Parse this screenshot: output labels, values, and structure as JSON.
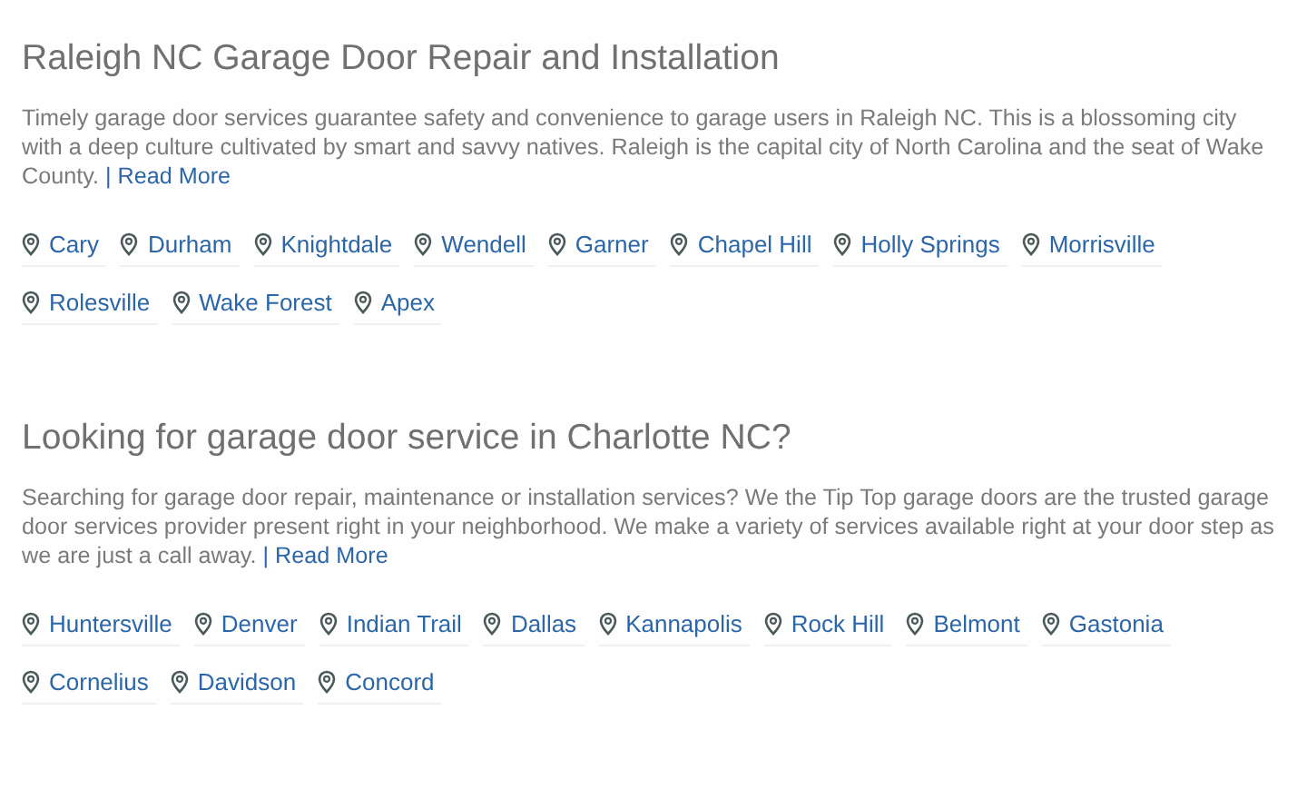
{
  "sections": [
    {
      "title": "Raleigh NC Garage Door Repair and Installation",
      "text": "Timely garage door services guarantee safety and convenience to garage users in Raleigh NC. This is a blossoming city with a deep culture cultivated by smart and savvy natives. Raleigh is the capital city of North Carolina and the seat of Wake County.",
      "link": "| Read More",
      "cities": [
        "Cary",
        "Durham",
        "Knightdale",
        "Wendell",
        "Garner",
        "Chapel Hill",
        "Holly Springs",
        "Morrisville",
        "Rolesville",
        "Wake Forest",
        "Apex"
      ]
    },
    {
      "title": "Looking for garage door service in Charlotte NC?",
      "text": "Searching for garage door repair, maintenance or installation services? We the Tip Top garage doors are the trusted garage door services provider present right in your neighborhood. We make a variety of services available right at your door step as we are just a call away.",
      "link": "| Read More",
      "cities": [
        "Huntersville",
        "Denver",
        "Indian Trail",
        "Dallas",
        "Kannapolis",
        "Rock Hill",
        "Belmont",
        "Gastonia",
        "Cornelius",
        "Davidson",
        "Concord"
      ]
    }
  ]
}
